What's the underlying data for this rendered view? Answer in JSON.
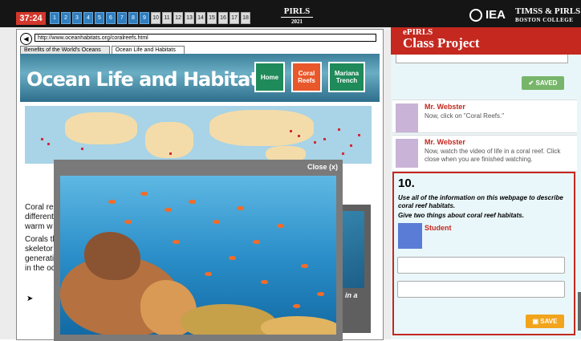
{
  "topbar": {
    "timer": "37:24",
    "question_numbers": [
      "1",
      "2",
      "3",
      "4",
      "5",
      "6",
      "7",
      "8",
      "9",
      "10",
      "11",
      "12",
      "13",
      "14",
      "15",
      "16",
      "17",
      "18"
    ],
    "pirls_logo": "PIRLS",
    "pirls_year": "2021",
    "iea_logo": "IEA",
    "timss_pirls": "TIMSS & PIRLS",
    "boston_college": "BOSTON COLLEGE",
    "colors": {
      "bar": "#151515",
      "timer": "#d2372c",
      "answered": "#2f7fc0"
    }
  },
  "browser": {
    "back_icon": "back-arrow-icon",
    "url": "http://www.oceanhabitats.org/coralreefs.html",
    "tabs": [
      "Benefits of the World's Oceans",
      "Ocean Life and Habitats"
    ],
    "banner_title": "Ocean Life and Habitats",
    "nav": [
      "Home",
      "Coral Reefs",
      "Mariana Trench"
    ],
    "body_text_fragments": [
      "Coral re",
      "different",
      "warm w",
      "Corals th",
      "skeletor",
      "generati",
      "in the oc"
    ],
    "background_card_text": "in a"
  },
  "modal": {
    "close_label": "Close (x)"
  },
  "right_panel": {
    "epirls": "ePIRLS",
    "class_project": "Class Project",
    "saved_label": "SAVED",
    "messages": [
      {
        "name": "Mr. Webster",
        "text": "Now, click on \"Coral Reefs.\""
      },
      {
        "name": "Mr. Webster",
        "text": "Now, watch the video of life in a coral reef. Click close when you are finished watching."
      }
    ],
    "question": {
      "number": "10.",
      "line1": "Use all of the information on this webpage to describe coral reef habitats.",
      "line2": "Give two things about coral reef habitats.",
      "student_label": "Student",
      "answer1": "",
      "answer2": "",
      "save_label": "SAVE"
    }
  }
}
